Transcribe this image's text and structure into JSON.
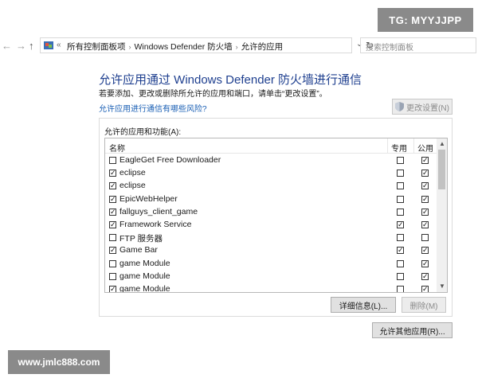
{
  "watermarks": {
    "top": "TG: MYYJJPP",
    "bottom": "www.jmlc888.com"
  },
  "nav": {
    "back": "←",
    "forward": "→",
    "up": "↑"
  },
  "address": {
    "chevron": "«",
    "crumbs": [
      "所有控制面板项",
      "Windows Defender 防火墙",
      "允许的应用"
    ],
    "separator": "›",
    "dropdown": "⌄",
    "refresh": "↻"
  },
  "search": {
    "placeholder": "搜索控制面板"
  },
  "page": {
    "title": "允许应用通过 Windows Defender 防火墙进行通信",
    "subtitle": "若要添加、更改或删除所允许的应用和端口，请单击“更改设置”。",
    "risk_link": "允许应用进行通信有哪些风险?",
    "change_settings": "更改设置(N)"
  },
  "apps": {
    "group_label": "允许的应用和功能(A):",
    "columns": {
      "name": "名称",
      "private": "专用",
      "public": "公用"
    },
    "rows": [
      {
        "name": "EagleGet Free Downloader",
        "enabled": false,
        "private": false,
        "public": true
      },
      {
        "name": "eclipse",
        "enabled": true,
        "private": false,
        "public": true
      },
      {
        "name": "eclipse",
        "enabled": true,
        "private": false,
        "public": true
      },
      {
        "name": "EpicWebHelper",
        "enabled": true,
        "private": false,
        "public": true
      },
      {
        "name": "fallguys_client_game",
        "enabled": true,
        "private": false,
        "public": true
      },
      {
        "name": "Framework Service",
        "enabled": true,
        "private": true,
        "public": true
      },
      {
        "name": "FTP 服务器",
        "enabled": false,
        "private": false,
        "public": false
      },
      {
        "name": "Game Bar",
        "enabled": true,
        "private": true,
        "public": true
      },
      {
        "name": "game Module",
        "enabled": false,
        "private": false,
        "public": true
      },
      {
        "name": "game Module",
        "enabled": false,
        "private": false,
        "public": true
      },
      {
        "name": "game Module",
        "enabled": true,
        "private": false,
        "public": true
      }
    ],
    "details_button": "详细信息(L)...",
    "remove_button": "删除(M)"
  },
  "allow_other_button": "允许其他应用(R)...",
  "colors": {
    "title": "#1e3f8f",
    "link": "#1a5fb4",
    "watermark_bg": "#8a8a8a"
  }
}
